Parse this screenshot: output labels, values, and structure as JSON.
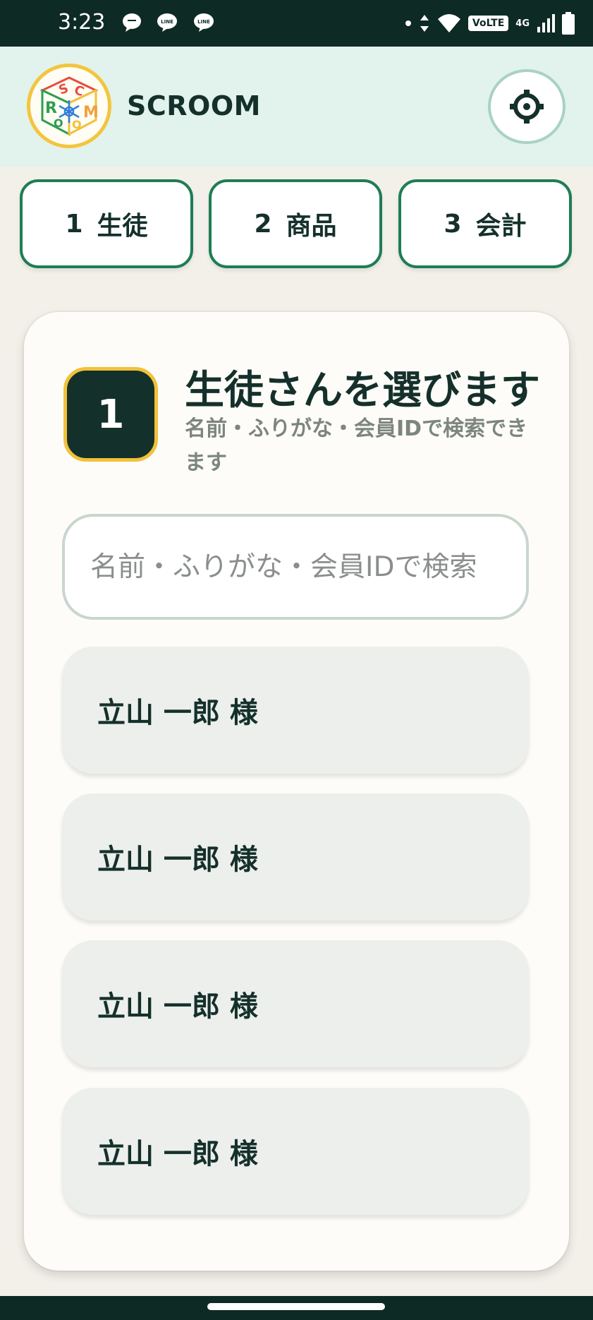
{
  "status_bar": {
    "time": "3:23",
    "notification_icons": [
      "chat-bubble-icon",
      "line-icon",
      "line-icon"
    ],
    "network_label": "VoLTE",
    "network_type": "4G"
  },
  "app": {
    "title": "SCROOM",
    "logo_text": "SCROOM",
    "settings_icon": "gear-icon"
  },
  "tabs": [
    {
      "number": "1",
      "label": "生徒"
    },
    {
      "number": "2",
      "label": "商品"
    },
    {
      "number": "3",
      "label": "会計"
    }
  ],
  "step": {
    "number": "1",
    "title": "生徒さんを選びます",
    "description": "名前・ふりがな・会員IDで検索できます"
  },
  "search": {
    "placeholder": "名前・ふりがな・会員IDで検索",
    "value": ""
  },
  "students": [
    {
      "name": "立山 一郎 様"
    },
    {
      "name": "立山 一郎 様"
    },
    {
      "name": "立山 一郎 様"
    },
    {
      "name": "立山 一郎 様"
    }
  ],
  "colors": {
    "primary_dark": "#14302a",
    "accent_green": "#1e7d55",
    "accent_yellow": "#f2c13a",
    "header_bg": "#e1f3ec"
  }
}
